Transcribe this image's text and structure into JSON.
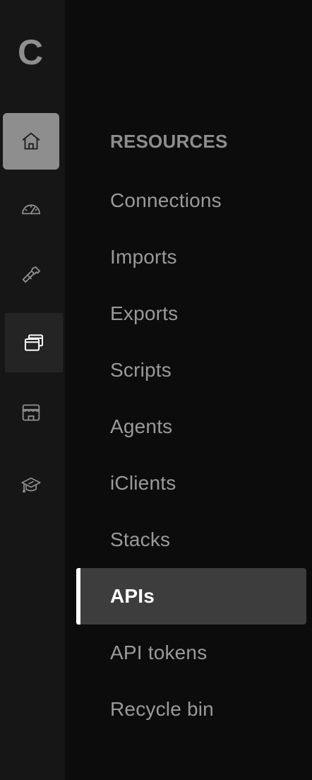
{
  "brand": {
    "logo_letter": "C"
  },
  "rail": {
    "items": [
      {
        "id": "home",
        "icon": "home-icon",
        "selected": false
      },
      {
        "id": "dashboard",
        "icon": "gauge-icon",
        "selected": false
      },
      {
        "id": "build",
        "icon": "hammer-icon",
        "selected": false
      },
      {
        "id": "resources",
        "icon": "windows-stack-icon",
        "selected": true
      },
      {
        "id": "marketplace",
        "icon": "storefront-icon",
        "selected": false
      },
      {
        "id": "learn",
        "icon": "graduation-cap-icon",
        "selected": false
      }
    ]
  },
  "panel": {
    "section_title": "RESOURCES",
    "items": [
      {
        "label": "Connections"
      },
      {
        "label": "Imports"
      },
      {
        "label": "Exports"
      },
      {
        "label": "Scripts"
      },
      {
        "label": "Agents"
      },
      {
        "label": "iClients"
      },
      {
        "label": "Stacks"
      },
      {
        "label": "APIs",
        "active": true
      },
      {
        "label": "API tokens"
      },
      {
        "label": "Recycle bin"
      }
    ]
  },
  "colors": {
    "rail_bg": "#161616",
    "panel_bg": "#0c0c0c",
    "home_active_bg": "#8e8e8e",
    "rail_selected_bg": "#242424",
    "item_active_bg": "#3d3d3d",
    "item_text": "#9a9a9a",
    "active_indicator": "#ffffff"
  }
}
